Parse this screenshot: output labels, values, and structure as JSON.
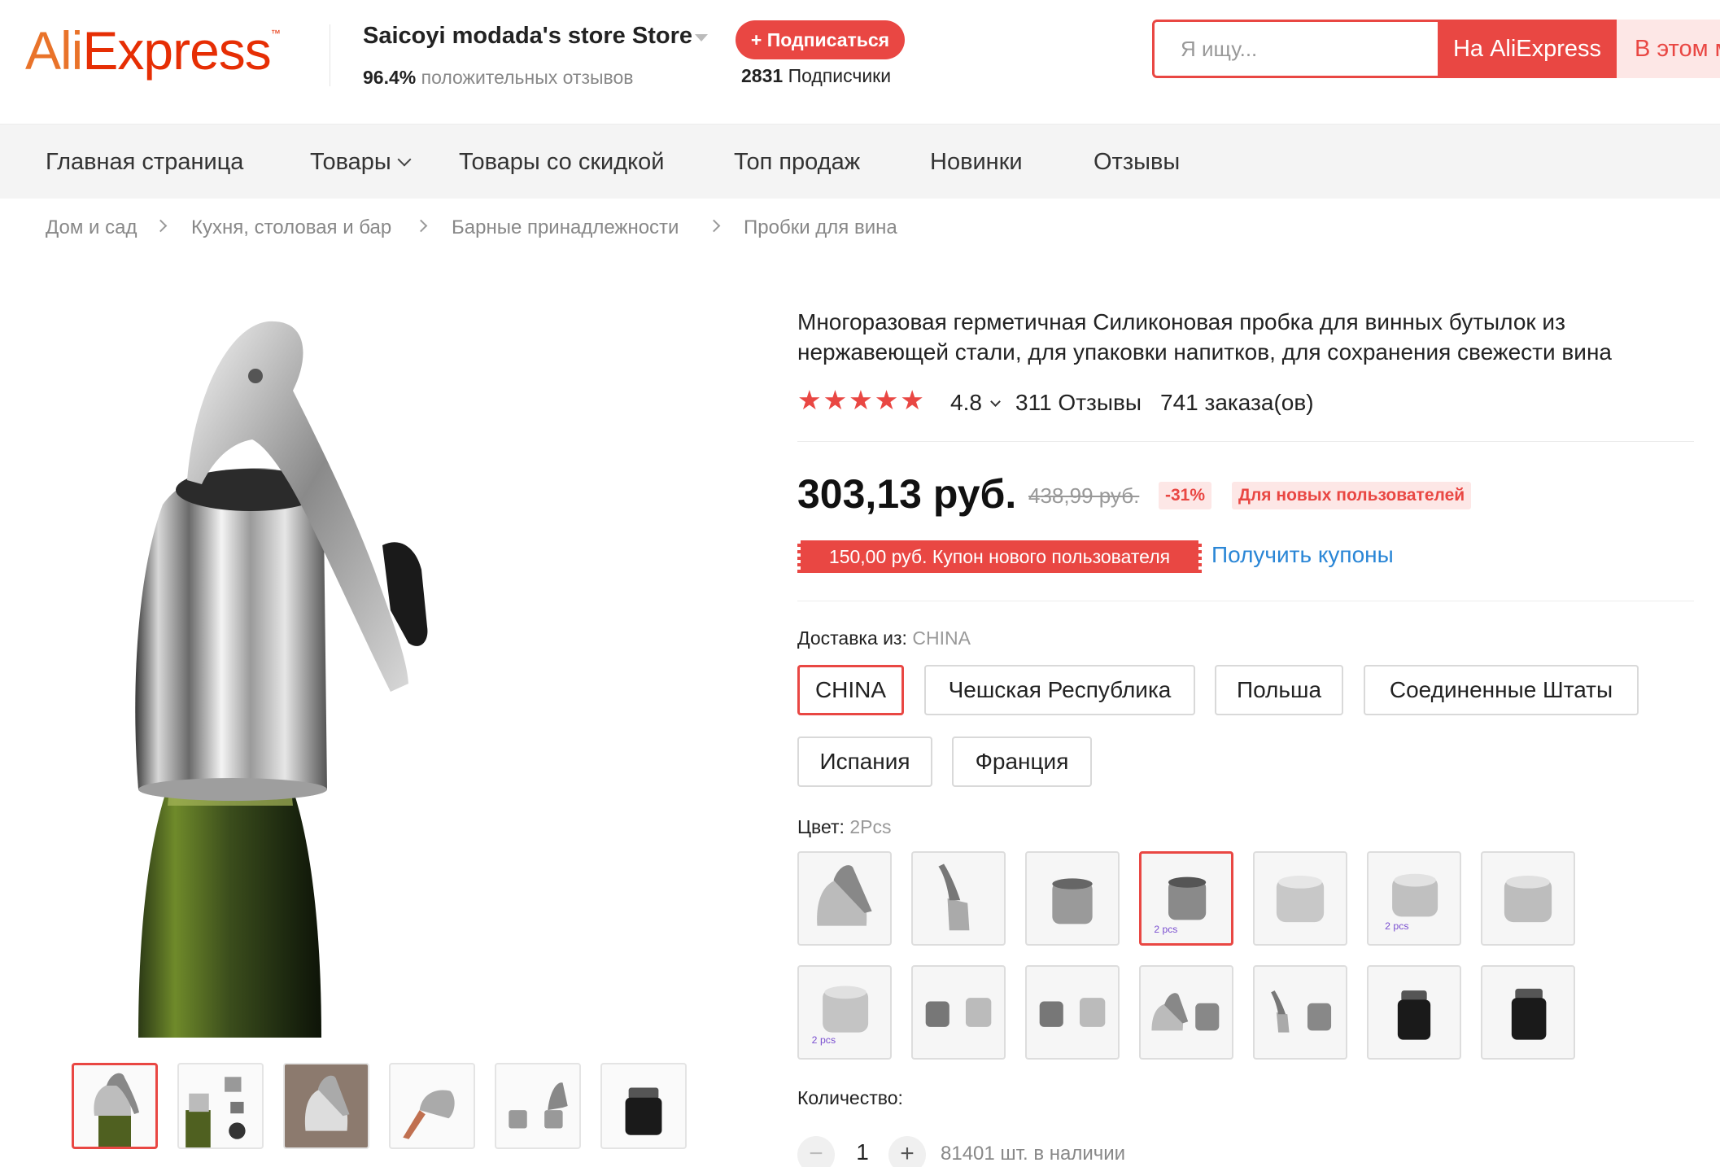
{
  "header": {
    "logo_ali": "Ali",
    "logo_express": "Express",
    "logo_tm": "™",
    "store_name": "Saicoyi modada's store Store",
    "positive_pct": "96.4%",
    "positive_label": "положительных отзывов",
    "follow_label": "+ Подписаться",
    "followers_count": "2831",
    "followers_label": "Подписчики",
    "search_placeholder": "Я ищу...",
    "search_ali_label": "На AliExpress",
    "search_store_label": "В этом м"
  },
  "nav": {
    "items": [
      "Главная страница",
      "Товары",
      "Товары со скидкой",
      "Топ продаж",
      "Новинки",
      "Отзывы"
    ]
  },
  "breadcrumb": [
    "Дом и сад",
    "Кухня, столовая и бар",
    "Барные принадлежности",
    "Пробки для вина"
  ],
  "product": {
    "title": "Многоразовая герметичная Силиконовая пробка для винных бутылок из нержавеющей стали, для упаковки напитков, для сохранения свежести вина",
    "stars": "★★★★★",
    "rating": "4.8",
    "reviews": "311 Отзывы",
    "orders": "741 заказа(ов)",
    "price": "303,13 руб.",
    "old_price": "438,99 руб.",
    "discount": "-31%",
    "new_user_tag": "Для новых пользователей",
    "coupon": "150,00 руб. Купон нового пользователя",
    "get_coupons": "Получить купоны",
    "ship_label": "Доставка из:",
    "ship_value": "CHINA",
    "ship_options": [
      "CHINA",
      "Чешская Республика",
      "Польша",
      "Соединенные Штаты",
      "Испания",
      "Франция"
    ],
    "ship_selected": "CHINA",
    "color_label": "Цвет:",
    "color_value": "2Pcs",
    "swatch_count": 14,
    "swatch_selected_index": 3,
    "swatch_caption_2pcs": "2 pcs",
    "qty_label": "Количество:",
    "qty_value": "1",
    "qty_minus": "−",
    "qty_plus": "+",
    "stock": "81401 шт. в наличии"
  },
  "colors": {
    "accent": "#e94743",
    "logo_orange": "#e9732a",
    "logo_red": "#e62e04",
    "link_blue": "#2a86d6"
  }
}
